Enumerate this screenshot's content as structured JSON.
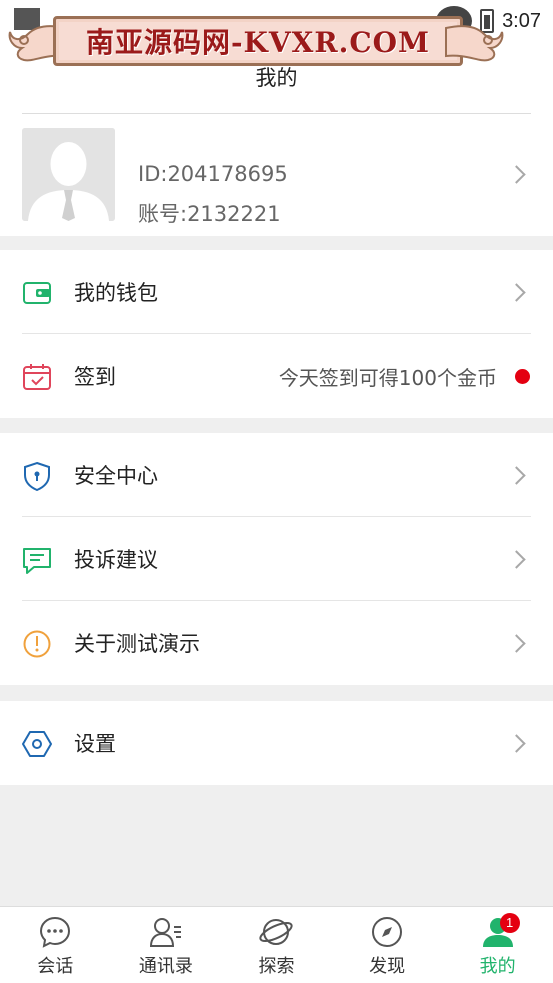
{
  "status_bar": {
    "time": "3:07"
  },
  "watermark": {
    "text": "南亚源码网-KVXR.COM"
  },
  "header": {
    "title": "我的"
  },
  "profile": {
    "id": "ID:204178695",
    "account": "账号:2132221"
  },
  "menu": {
    "wallet": {
      "label": "我的钱包",
      "icon": "wallet-icon"
    },
    "checkin": {
      "label": "签到",
      "extra": "今天签到可得100个金币",
      "icon": "calendar-icon"
    },
    "security": {
      "label": "安全中心",
      "icon": "shield-icon"
    },
    "feedback": {
      "label": "投诉建议",
      "icon": "message-icon"
    },
    "about": {
      "label": "关于测试演示",
      "icon": "info-icon"
    },
    "settings": {
      "label": "设置",
      "icon": "hexagon-icon"
    }
  },
  "tabs": [
    {
      "label": "会话",
      "icon": "chat-icon"
    },
    {
      "label": "通讯录",
      "icon": "contacts-icon"
    },
    {
      "label": "探索",
      "icon": "planet-icon"
    },
    {
      "label": "发现",
      "icon": "compass-icon"
    },
    {
      "label": "我的",
      "icon": "user-icon",
      "badge": "1",
      "active": true
    }
  ],
  "colors": {
    "accent": "#21b36c",
    "badge": "#e40011",
    "warning": "#f0a13c",
    "security": "#1f68b1",
    "checkin": "#e0455b"
  }
}
